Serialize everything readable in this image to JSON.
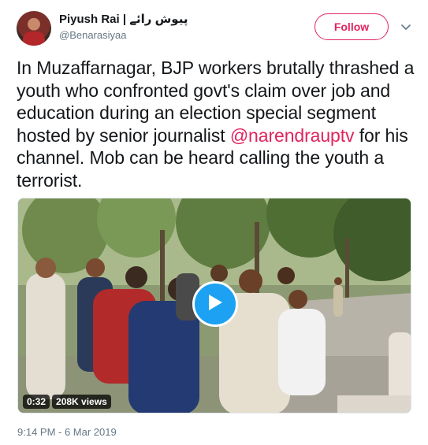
{
  "author": {
    "display_name": "Piyush Rai | پیوش رائے",
    "handle": "@Benarasiyaa"
  },
  "actions": {
    "follow_label": "Follow",
    "menu_icon": "chevron-down-icon"
  },
  "tweet": {
    "text_before": "In Muzaffarnagar, BJP workers brutally thrashed a youth who confronted govt's claim over job and education during an election special segment hosted by senior journalist ",
    "mention": "@narendraupt",
    "mention_tail": "v",
    "text_after": " for his channel. Mob can be heard calling the youth a terrorist."
  },
  "media": {
    "duration": "0:32",
    "views": "208K views",
    "play_icon": "play-icon"
  },
  "meta": {
    "timestamp": "9:14 PM - 6 Mar 2019"
  },
  "colors": {
    "accent": "#e0245e",
    "play": "#1da1f2",
    "text": "#14171a",
    "muted": "#657786"
  }
}
